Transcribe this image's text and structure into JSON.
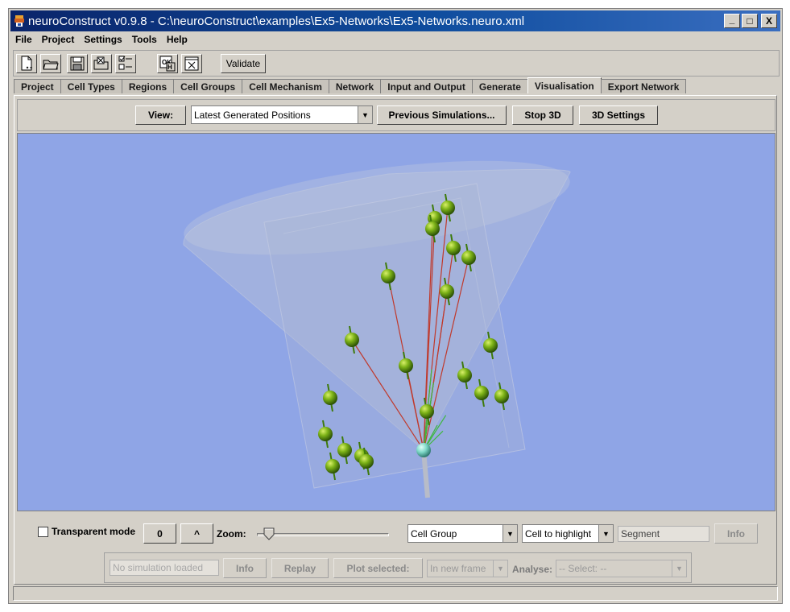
{
  "window": {
    "title": "neuroConstruct v0.9.8 - C:\\neuroConstruct\\examples\\Ex5-Networks\\Ex5-Networks.neuro.xml",
    "minimize_glyph": "_",
    "maximize_glyph": "□",
    "close_glyph": "X"
  },
  "menu": {
    "items": [
      "File",
      "Project",
      "Settings",
      "Tools",
      "Help"
    ]
  },
  "toolbar": {
    "icons": [
      "new-project-icon",
      "open-project-icon",
      "save-project-icon",
      "close-project-icon",
      "project-settings-icon",
      "neuron-h-icon",
      "close-icon"
    ],
    "validate_label": "Validate"
  },
  "tabs": {
    "items": [
      "Project",
      "Cell Types",
      "Regions",
      "Cell Groups",
      "Cell Mechanism",
      "Network",
      "Input and Output",
      "Generate",
      "Visualisation",
      "Export Network"
    ],
    "active": "Visualisation"
  },
  "view_bar": {
    "view_label": "View:",
    "view_value": "Latest Generated Positions",
    "previous_simulations_label": "Previous Simulations...",
    "stop_3d_label": "Stop 3D",
    "settings_3d_label": "3D Settings"
  },
  "viewport": {
    "background": "#8fa5e6",
    "cell_color": "#7db318",
    "highlight_cell_color": "#7fd9c8",
    "connection_color_red": "#c0392b",
    "connection_color_green": "#3fb83f"
  },
  "controls": {
    "transparent_mode_label": "Transparent mode",
    "transparent_mode_checked": false,
    "counter_value": "0",
    "up_label": "^",
    "zoom_label": "Zoom:",
    "zoom_level": 0.1,
    "cell_group_value": "Cell Group",
    "cell_to_highlight_value": "Cell to highlight",
    "segment_placeholder": "Segment",
    "info_label": "Info"
  },
  "simulation": {
    "status_placeholder": "No simulation loaded",
    "info_label": "Info",
    "replay_label": "Replay",
    "plot_selected_label": "Plot selected:",
    "plot_target_value": "In new frame",
    "analyse_label": "Analyse:",
    "analyse_value": "-- Select: --"
  }
}
